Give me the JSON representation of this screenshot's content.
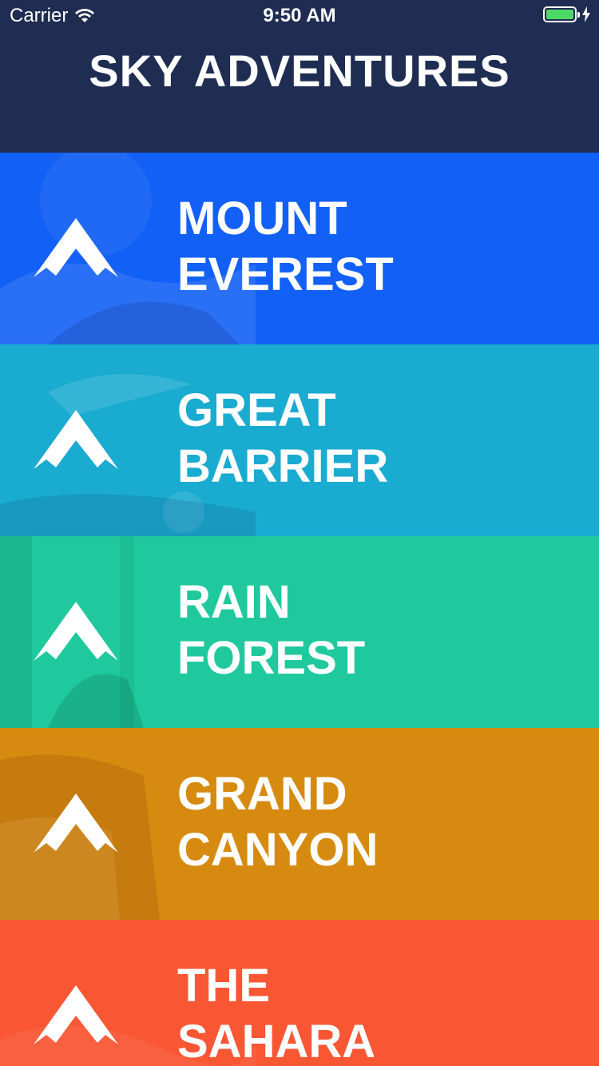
{
  "status_bar": {
    "carrier": "Carrier",
    "time": "9:50 AM"
  },
  "header": {
    "title": "SKY ADVENTURES"
  },
  "destinations": [
    {
      "line1": "MOUNT",
      "line2": "EVEREST",
      "color": "#1260f5",
      "icon": "mountain-icon"
    },
    {
      "line1": "GREAT",
      "line2": "BARRIER",
      "color": "#1aabd0",
      "icon": "mountain-icon"
    },
    {
      "line1": "RAIN",
      "line2": "FOREST",
      "color": "#1fc99d",
      "icon": "mountain-icon"
    },
    {
      "line1": "GRAND",
      "line2": "CANYON",
      "color": "#d68b10",
      "icon": "mountain-icon"
    },
    {
      "line1": "THE",
      "line2": "SAHARA",
      "color": "#f95734",
      "icon": "mountain-icon"
    }
  ]
}
